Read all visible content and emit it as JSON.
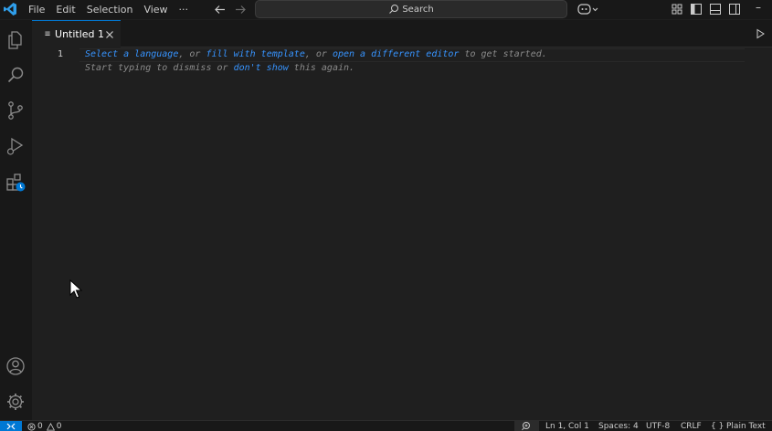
{
  "menu": [
    "File",
    "Edit",
    "Selection",
    "View",
    "···"
  ],
  "search": {
    "label": "Search"
  },
  "tab": {
    "icon_glyph": "≡",
    "label": "Untitled 1"
  },
  "editor": {
    "line_number": "1",
    "hint_line1": {
      "select_language": "Select a language",
      "sep1": ", or ",
      "fill_template": "fill with template",
      "sep2": ", or ",
      "open_editor": "open a different editor",
      "suffix": " to get started."
    },
    "hint_line2": {
      "prefix": "Start typing to dismiss or ",
      "dont_show": "don't show",
      "suffix": " this again."
    }
  },
  "statusbar": {
    "errors": "0",
    "warnings": "0",
    "position": "Ln 1, Col 1",
    "spaces": "Spaces: 4",
    "encoding": "UTF-8",
    "eol": "CRLF",
    "language_braces": "{ }",
    "language": "Plain Text"
  },
  "colors": {
    "accent": "#0078d4",
    "link": "#3794ff",
    "background": "#1f1f1f",
    "chrome": "#181818"
  }
}
